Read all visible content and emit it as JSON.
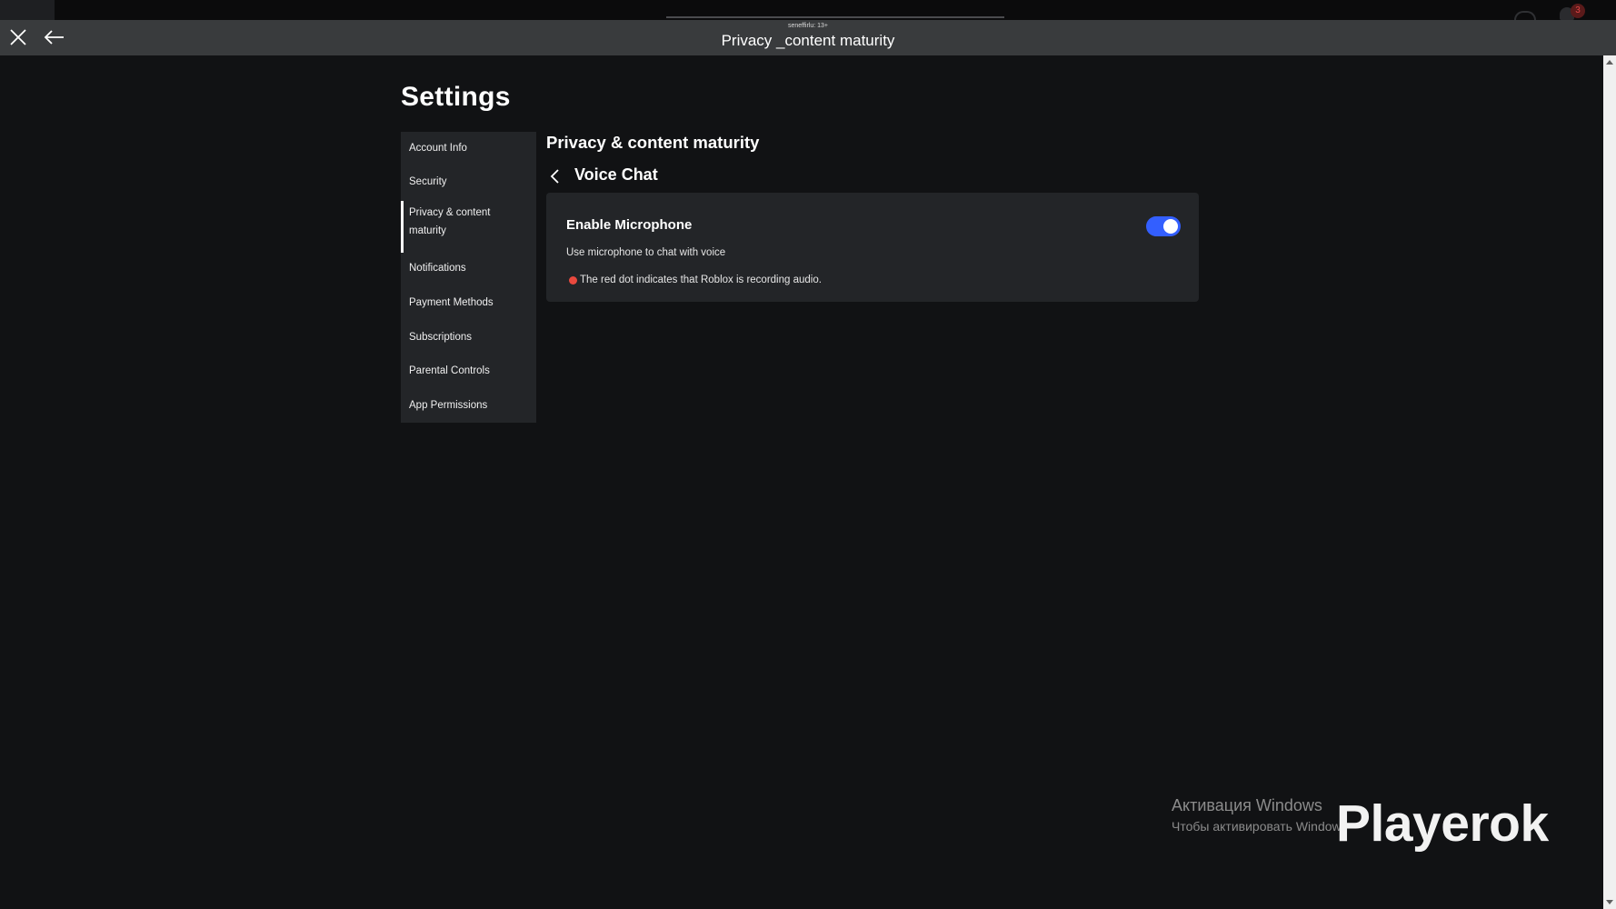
{
  "window": {
    "user_tag": "seneffirlu: 13+",
    "title": "Privacy _content maturity",
    "badge_count": "3"
  },
  "page": {
    "title": "Settings"
  },
  "sidebar": {
    "items": [
      {
        "label": "Account Info"
      },
      {
        "label": "Security"
      },
      {
        "label": "Privacy & content\nmaturity",
        "active": true
      },
      {
        "label": "Notifications"
      },
      {
        "label": "Payment Methods"
      },
      {
        "label": "Subscriptions"
      },
      {
        "label": "Parental Controls"
      },
      {
        "label": "App Permissions"
      }
    ]
  },
  "main": {
    "section_title": "Privacy & content maturity",
    "sub_title": "Voice Chat",
    "card": {
      "title": "Enable Microphone",
      "description": "Use microphone to chat with voice",
      "note": "The red dot indicates that Roblox is recording audio.",
      "toggle_on": true
    }
  },
  "overlay": {
    "activation_line1": "Активация Windows",
    "activation_line2": "Чтобы активировать Window",
    "watermark": "Playerok"
  },
  "colors": {
    "background": "#111214",
    "panel": "#232528",
    "titlebar": "#393b3d",
    "toggle_accent": "#335fff",
    "record_dot": "#e9493e"
  }
}
